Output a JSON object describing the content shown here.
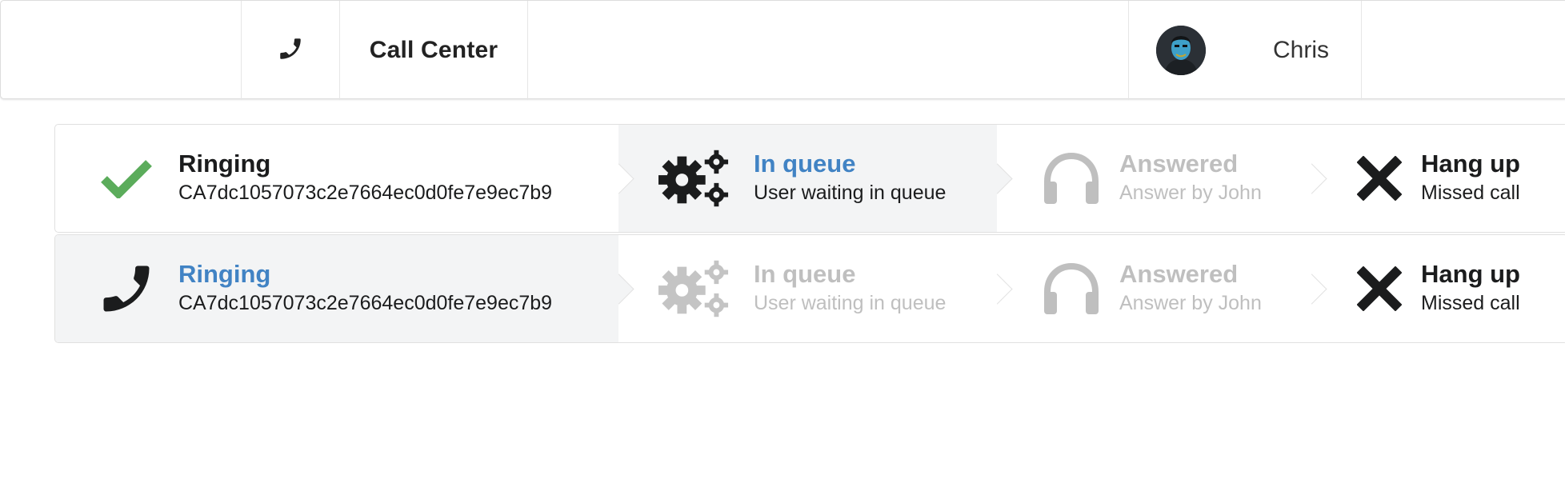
{
  "menu": {
    "title": "Call Center",
    "phone_icon": "phone-icon",
    "user": {
      "name": "Chris",
      "avatar_icon": "user-avatar"
    }
  },
  "colors": {
    "check": "#5bac5b",
    "active_title": "#4183c4",
    "disabled": "#bfbfbf",
    "dark_icon": "#1b1c1d"
  },
  "call_rows": [
    {
      "steps": [
        {
          "icon": "checkmark-icon",
          "state": "completed",
          "title": "Ringing",
          "description": "CA7dc1057073c2e7664ec0d0fe7e9ec7b9"
        },
        {
          "icon": "settings-gears-icon",
          "state": "active",
          "title": "In queue",
          "description": "User waiting in queue"
        },
        {
          "icon": "headphones-icon",
          "state": "disabled",
          "title": "Answered",
          "description": "Answer by John"
        },
        {
          "icon": "close-x-icon",
          "state": "completed",
          "title": "Hang up",
          "description": "Missed call"
        }
      ]
    },
    {
      "steps": [
        {
          "icon": "phone-icon",
          "state": "active",
          "title": "Ringing",
          "description": "CA7dc1057073c2e7664ec0d0fe7e9ec7b9"
        },
        {
          "icon": "settings-gears-icon",
          "state": "disabled",
          "title": "In queue",
          "description": "User waiting in queue"
        },
        {
          "icon": "headphones-icon",
          "state": "disabled",
          "title": "Answered",
          "description": "Answer by John"
        },
        {
          "icon": "close-x-icon",
          "state": "completed",
          "title": "Hang up",
          "description": "Missed call"
        }
      ]
    }
  ]
}
